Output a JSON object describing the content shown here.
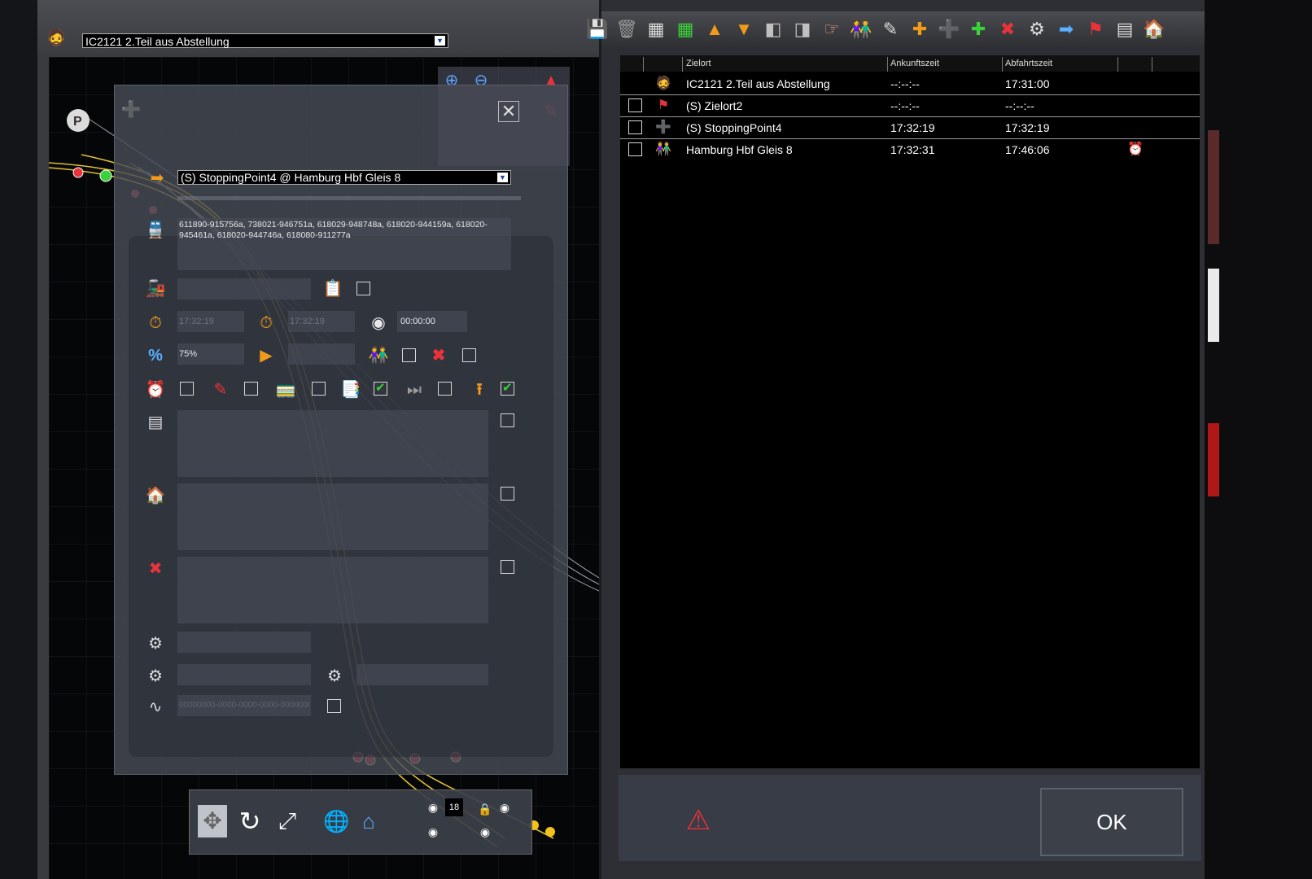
{
  "train": {
    "selected": "IC2121 2.Teil aus Abstellung"
  },
  "dialog": {
    "stop_selected": "(S) StoppingPoint4 @ Hamburg Hbf Gleis 8",
    "consist": "611890-915756a, 738021-946751a, 618029-948748a, 618020-944159a, 618020-945461a, 618020-944746a, 618080-911277a",
    "arrival_placeholder": "17:32:19",
    "departure_placeholder": "17:32:19",
    "dwell": "00:00:00",
    "percent": "75%",
    "uuid_placeholder": "00000000-0000-0000-0000-000000000000",
    "checkbox_states": {
      "reverse": true,
      "change_direction": true
    }
  },
  "schedule": {
    "columns": [
      "Zielort",
      "Ankunftszeit",
      "Abfahrtszeit"
    ],
    "rows": [
      {
        "icon": "driver-icon",
        "checkbox": false,
        "name": "IC2121 2.Teil aus Abstellung",
        "arrival": "--:--:--",
        "departure": "17:31:00",
        "alarm": false
      },
      {
        "icon": "flag-icon",
        "checkbox": true,
        "name": "(S) Zielort2",
        "arrival": "--:--:--",
        "departure": "--:--:--",
        "alarm": false
      },
      {
        "icon": "waypoint-plus-icon",
        "checkbox": true,
        "name": "(S) StoppingPoint4",
        "arrival": "17:32:19",
        "departure": "17:32:19",
        "alarm": false
      },
      {
        "icon": "passengers-icon",
        "checkbox": true,
        "name": "Hamburg Hbf Gleis 8",
        "arrival": "17:32:31",
        "departure": "17:46:06",
        "alarm": true
      }
    ]
  },
  "footer": {
    "ok_label": "OK"
  },
  "map_tools": {
    "counter": "18"
  },
  "colors": {
    "accent_orange": "#f29a1a",
    "check_green": "#3ad13a",
    "map_track": "#e2c030"
  }
}
